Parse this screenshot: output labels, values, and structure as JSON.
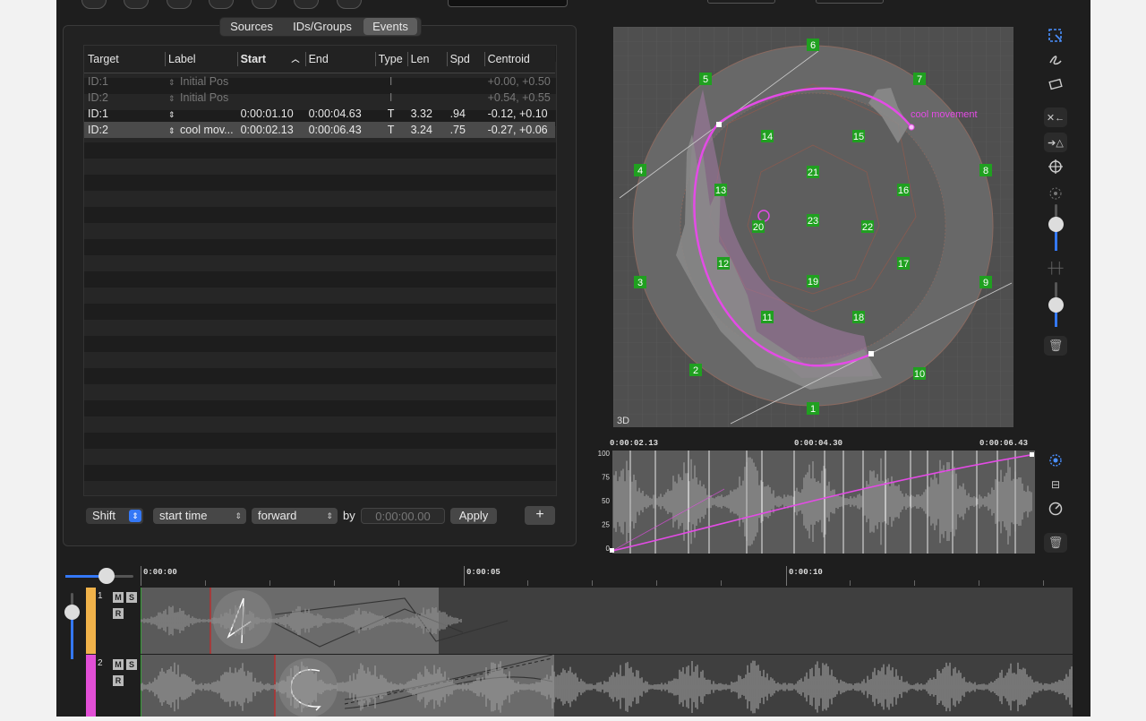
{
  "tabs": {
    "sources": "Sources",
    "ids_groups": "IDs/Groups",
    "events": "Events"
  },
  "table": {
    "headers": {
      "target": "Target",
      "label": "Label",
      "start": "Start",
      "end": "End",
      "type": "Type",
      "len": "Len",
      "spd": "Spd",
      "centroid": "Centroid"
    },
    "rows": [
      {
        "target": "ID:1",
        "label": "Initial Pos",
        "start": "",
        "end": "",
        "type": "I",
        "len": "",
        "spd": "",
        "centroid": "+0.00, +0.50",
        "dim": true,
        "selected": false
      },
      {
        "target": "ID:2",
        "label": "Initial Pos",
        "start": "",
        "end": "",
        "type": "I",
        "len": "",
        "spd": "",
        "centroid": "+0.54, +0.55",
        "dim": true,
        "selected": false
      },
      {
        "target": "ID:1",
        "label": "",
        "start": "0:00:01.10",
        "end": "0:00:04.63",
        "type": "T",
        "len": "3.32",
        "spd": ".94",
        "centroid": "-0.12, +0.10",
        "dim": false,
        "selected": false
      },
      {
        "target": "ID:2",
        "label": "cool mov...",
        "start": "0:00:02.13",
        "end": "0:00:06.43",
        "type": "T",
        "len": "3.24",
        "spd": ".75",
        "centroid": "-0.27, +0.06",
        "dim": false,
        "selected": true
      }
    ]
  },
  "controls": {
    "shift": "Shift",
    "field": "start time",
    "direction": "forward",
    "by": "by",
    "time_placeholder": "0:00:00.00",
    "apply": "Apply",
    "add": "+"
  },
  "spatial": {
    "label_3d": "3D",
    "annotation": "cool movement",
    "speakers": [
      "1",
      "2",
      "3",
      "4",
      "5",
      "6",
      "7",
      "8",
      "9",
      "10",
      "11",
      "12",
      "13",
      "14",
      "15",
      "16",
      "17",
      "18",
      "19",
      "20",
      "21",
      "22",
      "23"
    ]
  },
  "automation": {
    "t_start": "0:00:02.13",
    "t_mid": "0:00:04.30",
    "t_end": "0:00:06.43",
    "y_ticks": [
      "100",
      "75",
      "50",
      "25",
      "0"
    ]
  },
  "timeline": {
    "ruler": [
      "0:00:00",
      "0:00:05",
      "0:00:10"
    ],
    "tracks": [
      {
        "num": "1",
        "mute": "M",
        "solo": "S",
        "rec": "R",
        "color": "#f0b24a"
      },
      {
        "num": "2",
        "mute": "M",
        "solo": "S",
        "rec": "R",
        "color": "#e24fd6"
      }
    ]
  },
  "colors": {
    "accent": "#3478f6",
    "trajectory": "#e44be6",
    "speaker": "#20a020"
  }
}
